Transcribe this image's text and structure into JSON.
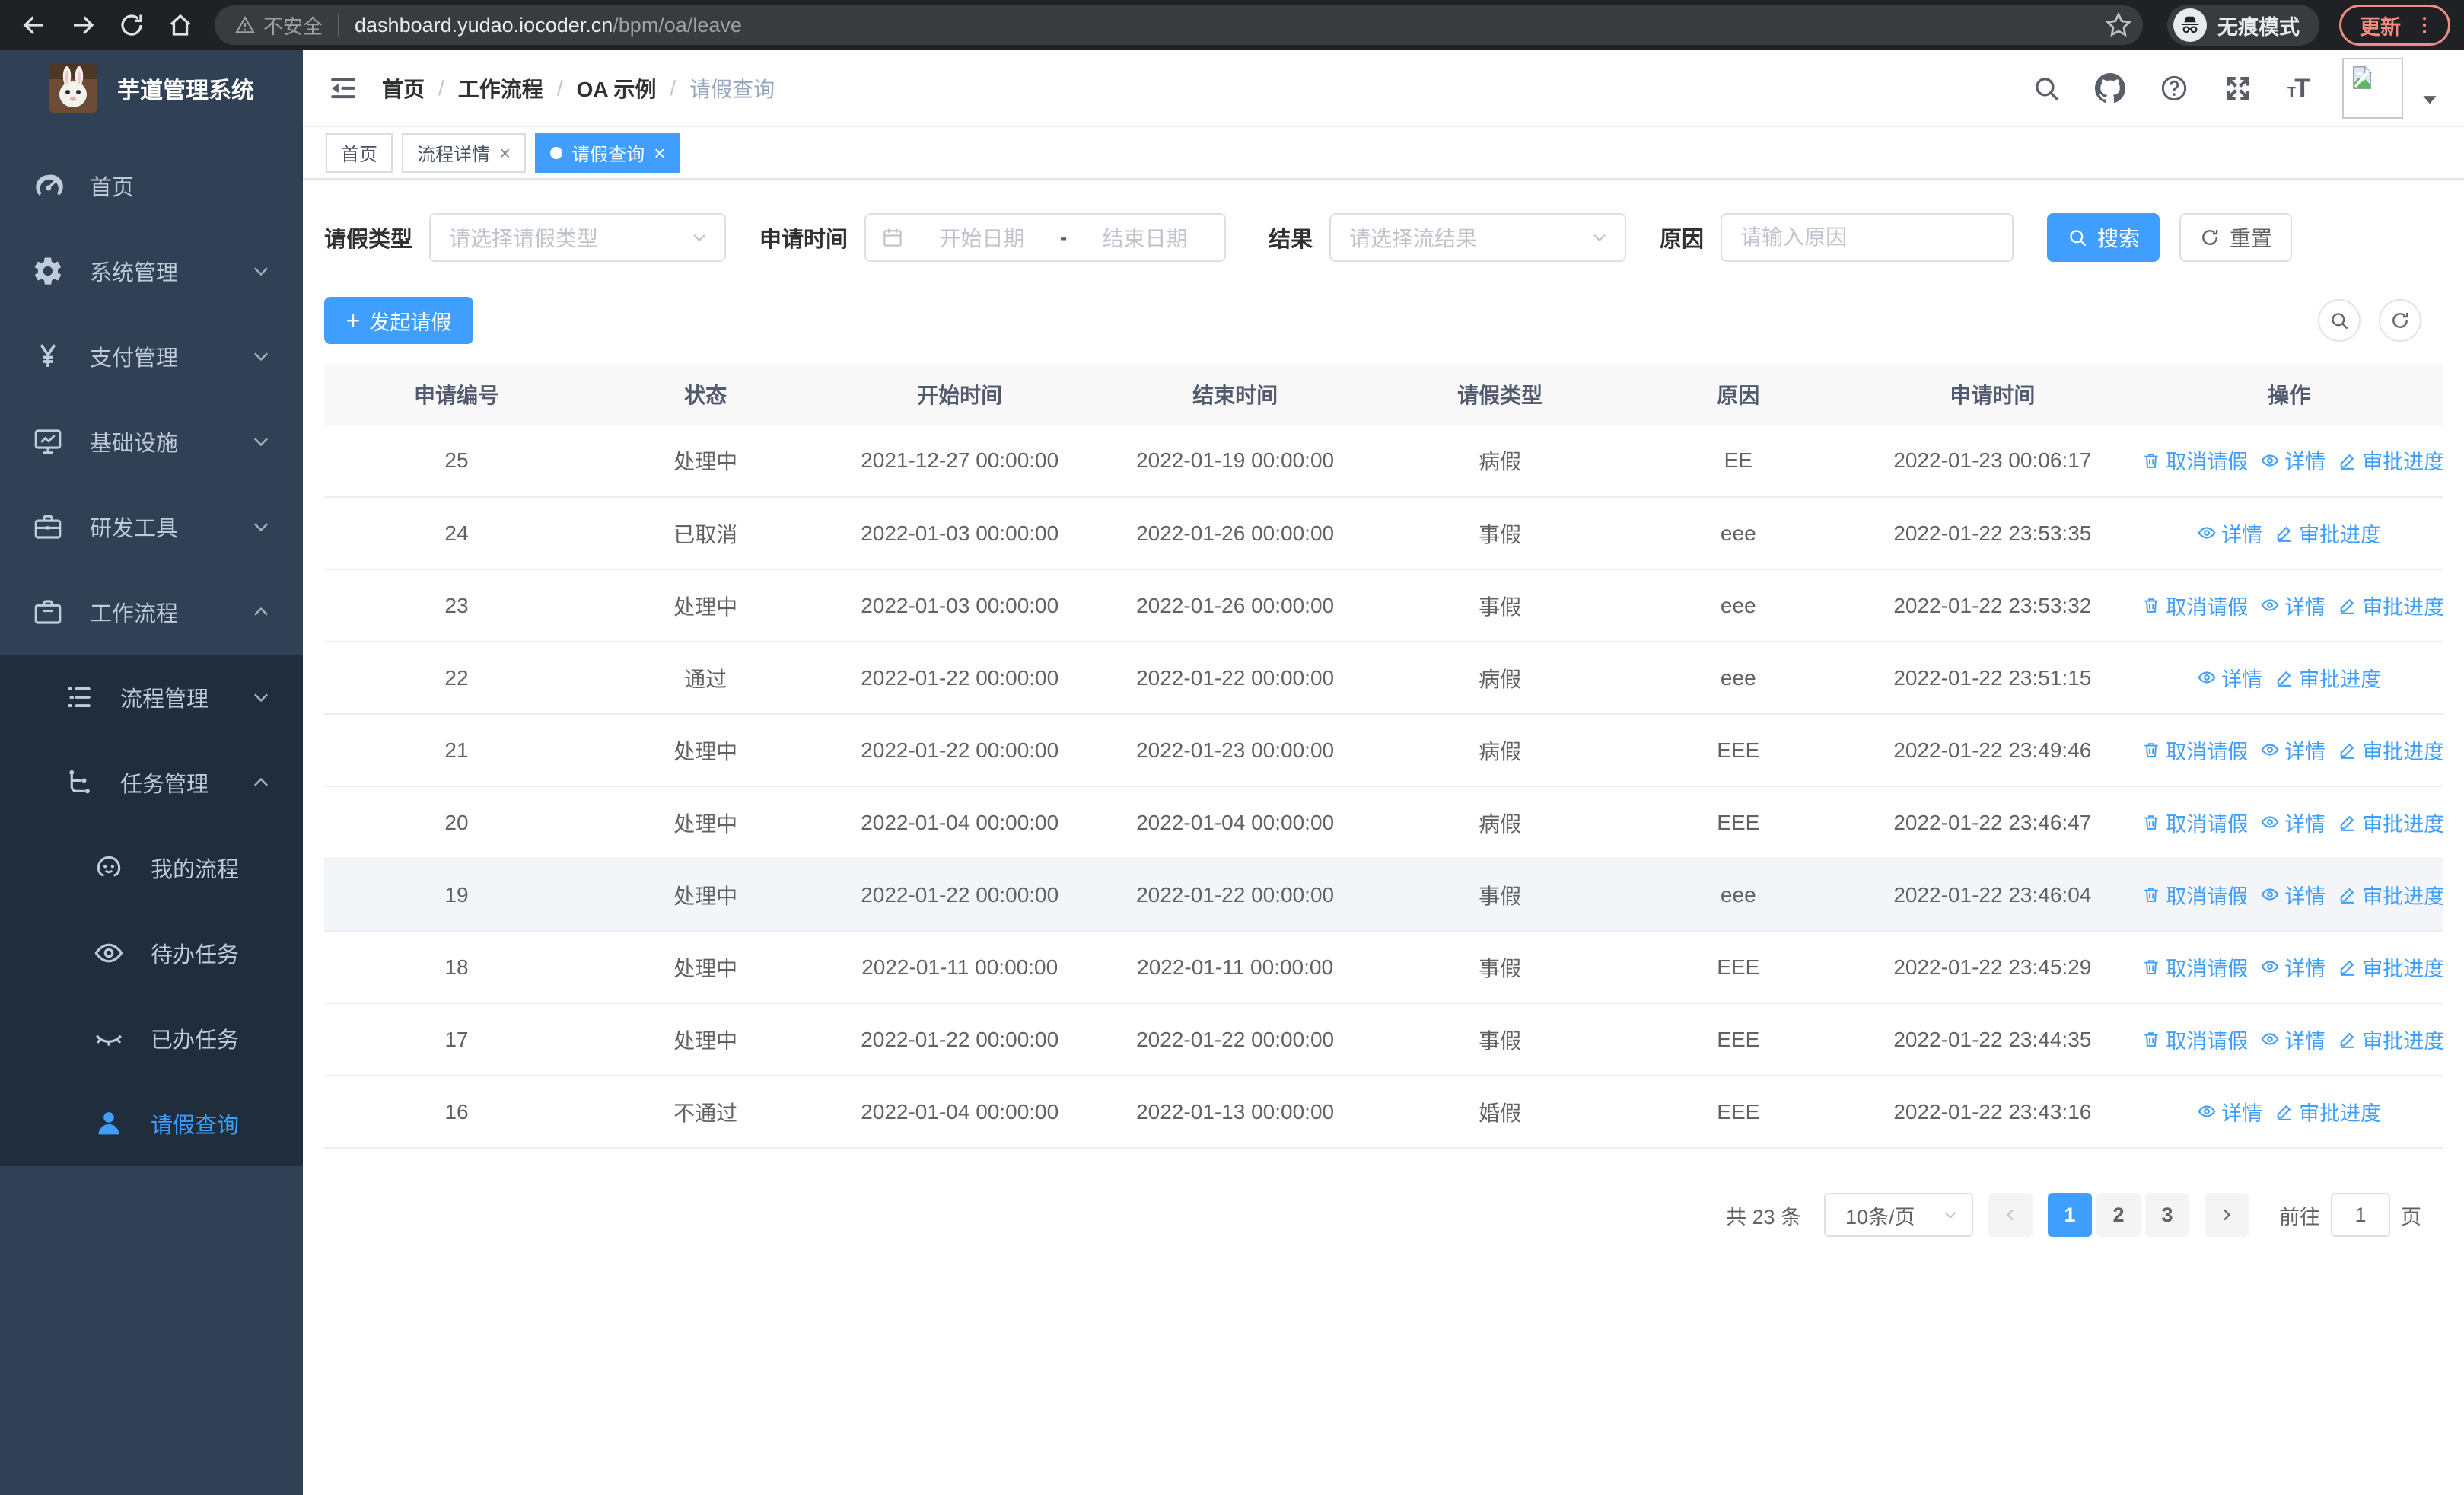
{
  "colors": {
    "accent": "#409eff",
    "sidebar_bg": "#304156",
    "submenu_bg": "#1f2d3d",
    "update_pill": "#f28b82",
    "table_header_bg": "#f8f8f9"
  },
  "browser": {
    "security_label": "不安全",
    "url_domain": "dashboard.yudao.iocoder.cn",
    "url_path": "/bpm/oa/leave",
    "incognito_label": "无痕模式",
    "update_label": "更新"
  },
  "sidebar": {
    "title": "芋道管理系统",
    "items": [
      {
        "key": "home",
        "label": "首页",
        "icon": "dashboard",
        "level": 1,
        "chevron": "",
        "sub": false,
        "active": false
      },
      {
        "key": "system-management",
        "label": "系统管理",
        "icon": "gear",
        "level": 1,
        "chevron": "down",
        "sub": false,
        "active": false
      },
      {
        "key": "payment-management",
        "label": "支付管理",
        "icon": "yen",
        "level": 1,
        "chevron": "down",
        "sub": false,
        "active": false
      },
      {
        "key": "infrastructure",
        "label": "基础设施",
        "icon": "monitor",
        "level": 1,
        "chevron": "down",
        "sub": false,
        "active": false
      },
      {
        "key": "dev-tools",
        "label": "研发工具",
        "icon": "toolbox",
        "level": 1,
        "chevron": "down",
        "sub": false,
        "active": false
      },
      {
        "key": "workflow",
        "label": "工作流程",
        "icon": "briefcase",
        "level": 1,
        "chevron": "up",
        "sub": false,
        "active": false
      },
      {
        "key": "process-management",
        "label": "流程管理",
        "icon": "list",
        "level": 2,
        "chevron": "down",
        "sub": true,
        "active": false
      },
      {
        "key": "task-management",
        "label": "任务管理",
        "icon": "tree",
        "level": 2,
        "chevron": "up",
        "sub": true,
        "active": false
      },
      {
        "key": "my-process",
        "label": "我的流程",
        "icon": "robot",
        "level": 3,
        "chevron": "",
        "sub": true,
        "active": false
      },
      {
        "key": "todo-tasks",
        "label": "待办任务",
        "icon": "eye-open",
        "level": 3,
        "chevron": "",
        "sub": true,
        "active": false
      },
      {
        "key": "done-tasks",
        "label": "已办任务",
        "icon": "eye-closed",
        "level": 3,
        "chevron": "",
        "sub": true,
        "active": false
      },
      {
        "key": "leave-query",
        "label": "请假查询",
        "icon": "user",
        "level": 3,
        "chevron": "",
        "sub": true,
        "active": true
      }
    ]
  },
  "header": {
    "breadcrumb": [
      "首页",
      "工作流程",
      "OA 示例",
      "请假查询"
    ]
  },
  "tabs": [
    {
      "key": "home",
      "label": "首页",
      "closable": false,
      "active": false
    },
    {
      "key": "process-detail",
      "label": "流程详情",
      "closable": true,
      "active": false
    },
    {
      "key": "leave-query",
      "label": "请假查询",
      "closable": true,
      "active": true
    }
  ],
  "filters": {
    "leave_type": {
      "label": "请假类型",
      "placeholder": "请选择请假类型"
    },
    "apply_time": {
      "label": "申请时间",
      "start_placeholder": "开始日期",
      "separator": "-",
      "end_placeholder": "结束日期"
    },
    "result": {
      "label": "结果",
      "placeholder": "请选择流结果"
    },
    "reason": {
      "label": "原因",
      "placeholder": "请输入原因"
    },
    "search_label": "搜索",
    "reset_label": "重置"
  },
  "toolbar": {
    "create_label": "发起请假",
    "plus_glyph": "+"
  },
  "table": {
    "columns": [
      "申请编号",
      "状态",
      "开始时间",
      "结束时间",
      "请假类型",
      "原因",
      "申请时间",
      "操作"
    ],
    "column_keys": [
      "apply-id",
      "status",
      "start-time",
      "end-time",
      "leave-type",
      "reason",
      "apply-time"
    ],
    "action_defs": {
      "cancel": {
        "label": "取消请假",
        "icon": "trash"
      },
      "detail": {
        "label": "详情",
        "icon": "eye-action"
      },
      "progress": {
        "label": "审批进度",
        "icon": "edit"
      }
    },
    "rows": [
      {
        "id": "25",
        "status": "处理中",
        "start_time": "2021-12-27 00:00:00",
        "end_time": "2022-01-19 00:00:00",
        "leave_type": "病假",
        "reason": "EE",
        "apply_time": "2022-01-23 00:06:17",
        "actions": [
          "cancel",
          "detail",
          "progress"
        ],
        "highlighted": false
      },
      {
        "id": "24",
        "status": "已取消",
        "start_time": "2022-01-03 00:00:00",
        "end_time": "2022-01-26 00:00:00",
        "leave_type": "事假",
        "reason": "eee",
        "apply_time": "2022-01-22 23:53:35",
        "actions": [
          "detail",
          "progress"
        ],
        "highlighted": false
      },
      {
        "id": "23",
        "status": "处理中",
        "start_time": "2022-01-03 00:00:00",
        "end_time": "2022-01-26 00:00:00",
        "leave_type": "事假",
        "reason": "eee",
        "apply_time": "2022-01-22 23:53:32",
        "actions": [
          "cancel",
          "detail",
          "progress"
        ],
        "highlighted": false
      },
      {
        "id": "22",
        "status": "通过",
        "start_time": "2022-01-22 00:00:00",
        "end_time": "2022-01-22 00:00:00",
        "leave_type": "病假",
        "reason": "eee",
        "apply_time": "2022-01-22 23:51:15",
        "actions": [
          "detail",
          "progress"
        ],
        "highlighted": false
      },
      {
        "id": "21",
        "status": "处理中",
        "start_time": "2022-01-22 00:00:00",
        "end_time": "2022-01-23 00:00:00",
        "leave_type": "病假",
        "reason": "EEE",
        "apply_time": "2022-01-22 23:49:46",
        "actions": [
          "cancel",
          "detail",
          "progress"
        ],
        "highlighted": false
      },
      {
        "id": "20",
        "status": "处理中",
        "start_time": "2022-01-04 00:00:00",
        "end_time": "2022-01-04 00:00:00",
        "leave_type": "病假",
        "reason": "EEE",
        "apply_time": "2022-01-22 23:46:47",
        "actions": [
          "cancel",
          "detail",
          "progress"
        ],
        "highlighted": false
      },
      {
        "id": "19",
        "status": "处理中",
        "start_time": "2022-01-22 00:00:00",
        "end_time": "2022-01-22 00:00:00",
        "leave_type": "事假",
        "reason": "eee",
        "apply_time": "2022-01-22 23:46:04",
        "actions": [
          "cancel",
          "detail",
          "progress"
        ],
        "highlighted": true
      },
      {
        "id": "18",
        "status": "处理中",
        "start_time": "2022-01-11 00:00:00",
        "end_time": "2022-01-11 00:00:00",
        "leave_type": "事假",
        "reason": "EEE",
        "apply_time": "2022-01-22 23:45:29",
        "actions": [
          "cancel",
          "detail",
          "progress"
        ],
        "highlighted": false
      },
      {
        "id": "17",
        "status": "处理中",
        "start_time": "2022-01-22 00:00:00",
        "end_time": "2022-01-22 00:00:00",
        "leave_type": "事假",
        "reason": "EEE",
        "apply_time": "2022-01-22 23:44:35",
        "actions": [
          "cancel",
          "detail",
          "progress"
        ],
        "highlighted": false
      },
      {
        "id": "16",
        "status": "不通过",
        "start_time": "2022-01-04 00:00:00",
        "end_time": "2022-01-13 00:00:00",
        "leave_type": "婚假",
        "reason": "EEE",
        "apply_time": "2022-01-22 23:43:16",
        "actions": [
          "detail",
          "progress"
        ],
        "highlighted": false
      }
    ]
  },
  "pagination": {
    "total_label": "共 23 条",
    "page_size_label": "10条/页",
    "pages": [
      "1",
      "2",
      "3"
    ],
    "active_page": "1",
    "goto_label": "前往",
    "goto_value": "1",
    "page_unit_label": "页"
  }
}
